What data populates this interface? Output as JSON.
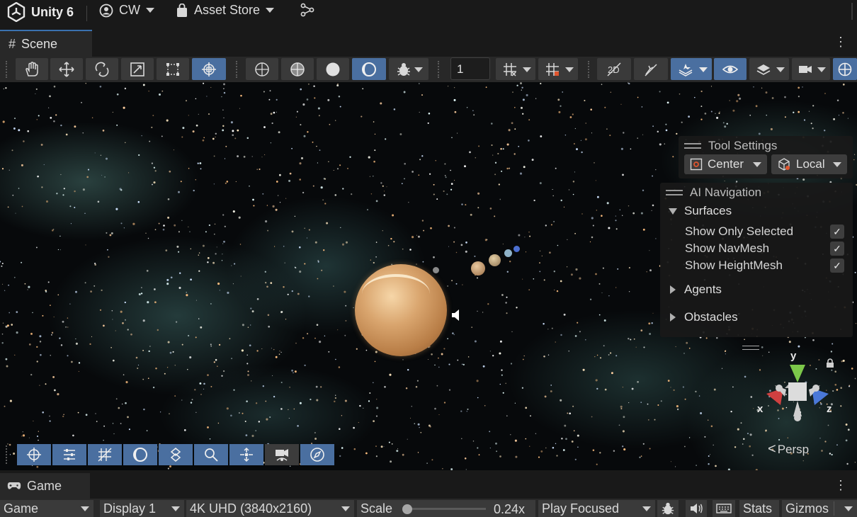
{
  "topbar": {
    "app_title": "Unity 6",
    "account": "CW",
    "asset_store": "Asset Store"
  },
  "scene_tab": {
    "label": "Scene"
  },
  "toolbar": {
    "grid_size_value": "1"
  },
  "tool_settings": {
    "title": "Tool Settings",
    "pivot_label": "Center",
    "space_label": "Local"
  },
  "ai_navigation": {
    "title": "AI Navigation",
    "surfaces_label": "Surfaces",
    "options": [
      {
        "label": "Show Only Selected",
        "checked": true
      },
      {
        "label": "Show NavMesh",
        "checked": true
      },
      {
        "label": "Show HeightMesh",
        "checked": true
      }
    ],
    "agents_label": "Agents",
    "obstacles_label": "Obstacles"
  },
  "gizmo": {
    "y_label": "y",
    "x_label": "x",
    "z_label": "z",
    "projection_label": "Persp"
  },
  "game_tab": {
    "label": "Game"
  },
  "game_bar": {
    "view_mode": "Game",
    "display": "Display 1",
    "resolution": "4K UHD (3840x2160)",
    "scale_label": "Scale",
    "scale_value": "0.24x",
    "play_mode": "Play Focused",
    "stats_label": "Stats",
    "gizmos_label": "Gizmos"
  },
  "colors": {
    "accent_blue": "#4a6fa0",
    "panel_bg": "#191919",
    "toolbar_bg": "#282828",
    "axis_x": "#d04040",
    "axis_y": "#7cc84a",
    "axis_z": "#4a78d8"
  }
}
